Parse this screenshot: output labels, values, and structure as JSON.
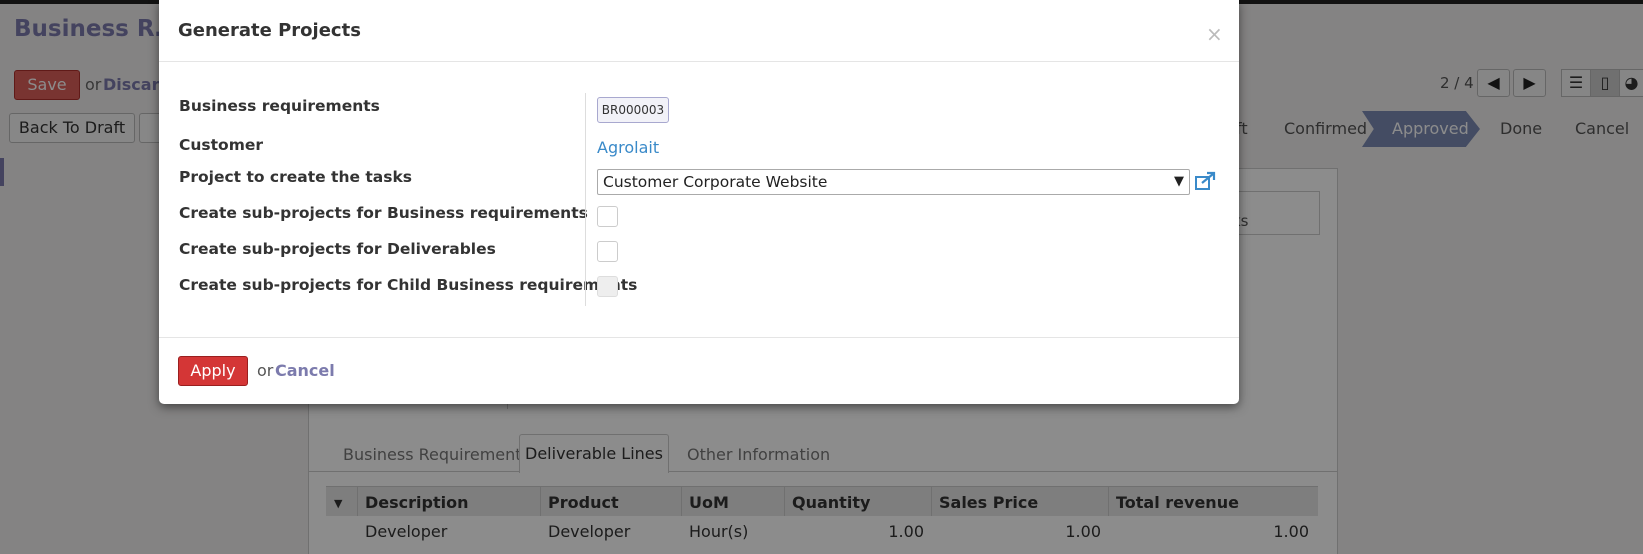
{
  "app": {
    "title": "Business R…",
    "save_label": "Save",
    "or_label": "or",
    "discard_label": "Discard",
    "pager": "2 / 4",
    "back_to_draft_label": "Back To Draft",
    "status_steps": [
      "ft",
      "Confirmed",
      "Approved",
      "Done",
      "Cancel"
    ],
    "active_status": "Approved",
    "side_box_text": "ks",
    "tabs": [
      "Business Requirement",
      "Deliverable Lines",
      "Other Information"
    ],
    "active_tab": "Deliverable Lines",
    "table": {
      "columns": [
        "Description",
        "Product",
        "UoM",
        "Quantity",
        "Sales Price",
        "Total revenue"
      ],
      "rows": [
        [
          "Developer",
          "Developer",
          "Hour(s)",
          "1.00",
          "1.00",
          "1.00"
        ]
      ]
    }
  },
  "modal": {
    "title": "Generate Projects",
    "close_label": "×",
    "fields": {
      "business_requirements_label": "Business requirements",
      "business_requirements_value": "BR000003",
      "customer_label": "Customer",
      "customer_value": "Agrolait",
      "project_label": "Project to create the tasks",
      "project_value": "Customer Corporate Website",
      "sub_br_label": "Create sub-projects for Business requirements",
      "sub_deliverables_label": "Create sub-projects for Deliverables",
      "sub_child_br_label": "Create sub-projects for Child Business requirements"
    },
    "apply_label": "Apply",
    "or_label": "or",
    "cancel_label": "Cancel"
  },
  "colors": {
    "primary": "#7c7bad",
    "danger": "#d43636",
    "link": "#3a8ac9",
    "status_active": "#7c8ab5"
  }
}
